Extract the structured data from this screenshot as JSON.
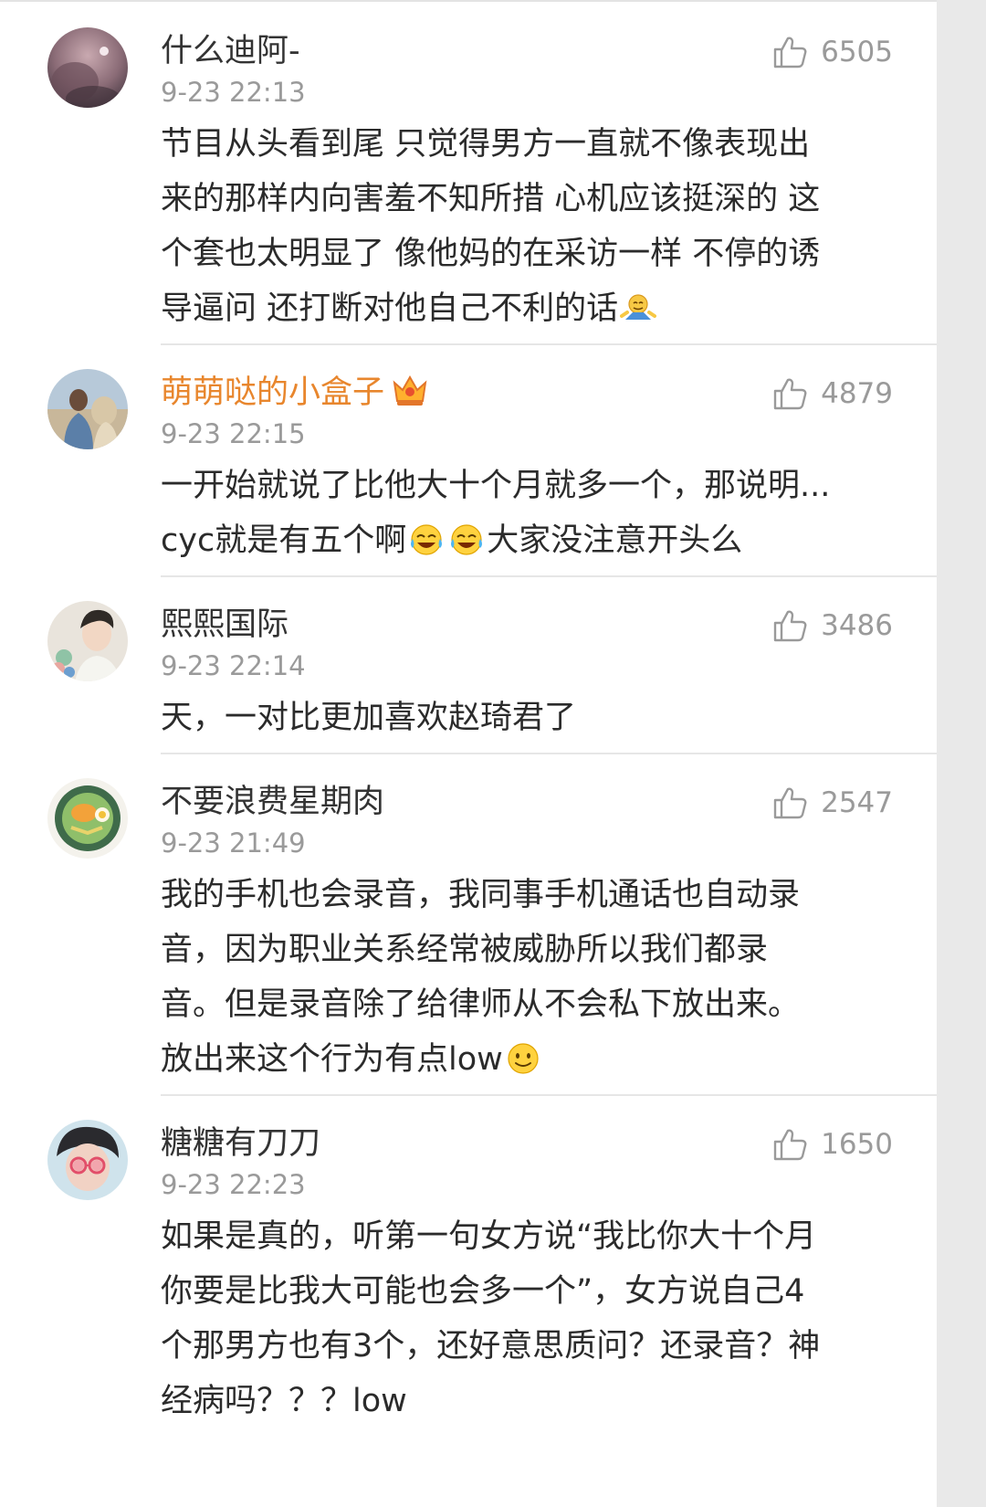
{
  "comments": [
    {
      "username": "什么迪阿-",
      "time": "9-23 22:13",
      "likes": "6505",
      "lines": [
        "节目从头看到尾 只觉得男方一直就不像表现出",
        "来的那样内向害羞不知所措 心机应该挺深的 这",
        "个套也太明显了 像他妈的在采访一样 不停的诱",
        "导逼问 还打断对他自己不利的话"
      ],
      "emoji": "shrug-emoji"
    },
    {
      "username": "萌萌哒的小盒子",
      "badge": "crown-badge",
      "time": "9-23 22:15",
      "likes": "4879",
      "lines": [
        "一开始就说了比他大十个月就多一个，那说明...",
        "cyc就是有五个啊",
        "大家没注意开头么"
      ],
      "emoji": "laugh-cry-emoji"
    },
    {
      "username": "熙熙国际",
      "time": "9-23 22:14",
      "likes": "3486",
      "lines": [
        "天，一对比更加喜欢赵琦君了"
      ]
    },
    {
      "username": "不要浪费星期肉",
      "time": "9-23 21:49",
      "likes": "2547",
      "lines": [
        "我的手机也会录音，我同事手机通话也自动录",
        "音，因为职业关系经常被威胁所以我们都录",
        "音。但是录音除了给律师从不会私下放出来。",
        "放出来这个行为有点low"
      ],
      "emoji": "smile-emoji"
    },
    {
      "username": "糖糖有刀刀",
      "time": "9-23 22:23",
      "likes": "1650",
      "lines": [
        "如果是真的，听第一句女方说“我比你大十个月",
        "你要是比我大可能也会多一个”，女方说自己4",
        "个那男方也有3个，还好意思质问？还录音？神",
        "经病吗？？？low"
      ]
    }
  ],
  "colors": {
    "username": "#333333",
    "vip_username": "#e8862d",
    "meta": "#9a9a9a",
    "text": "#2b2b2b",
    "divider": "#e6e6e6"
  }
}
